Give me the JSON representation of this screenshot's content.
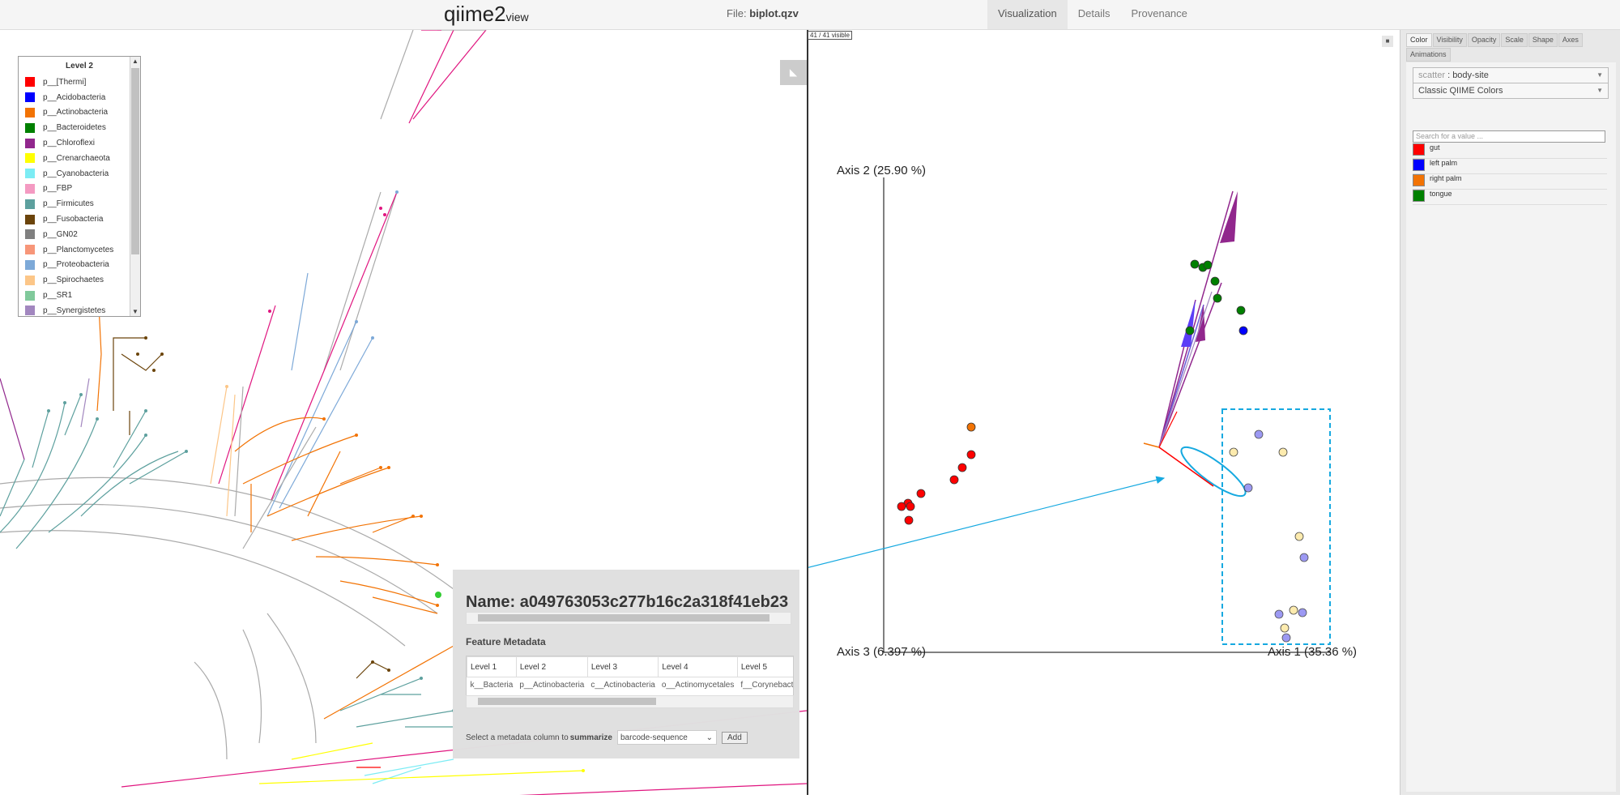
{
  "header": {
    "logo": {
      "brand": "qiime2",
      "suffix": "view"
    },
    "file_prefix": "File:",
    "file_name": "biplot.qzv",
    "tabs": [
      {
        "label": "Visualization",
        "active": true
      },
      {
        "label": "Details",
        "active": false
      },
      {
        "label": "Provenance",
        "active": false
      }
    ]
  },
  "tree_panel": {
    "collapse_icon": "arrow-icon",
    "legend": {
      "title": "Level 2",
      "items": [
        {
          "label": "p__[Thermi]",
          "color": "#ff0000"
        },
        {
          "label": "p__Acidobacteria",
          "color": "#0000ff"
        },
        {
          "label": "p__Actinobacteria",
          "color": "#f27304"
        },
        {
          "label": "p__Bacteroidetes",
          "color": "#008000"
        },
        {
          "label": "p__Chloroflexi",
          "color": "#91278d"
        },
        {
          "label": "p__Crenarchaeota",
          "color": "#ffff00"
        },
        {
          "label": "p__Cyanobacteria",
          "color": "#7cecf4"
        },
        {
          "label": "p__FBP",
          "color": "#f49ac2"
        },
        {
          "label": "p__Firmicutes",
          "color": "#5da09e"
        },
        {
          "label": "p__Fusobacteria",
          "color": "#6b440b"
        },
        {
          "label": "p__GN02",
          "color": "#808080"
        },
        {
          "label": "p__Planctomycetes",
          "color": "#f79679"
        },
        {
          "label": "p__Proteobacteria",
          "color": "#7da9d8"
        },
        {
          "label": "p__Spirochaetes",
          "color": "#fcc688"
        },
        {
          "label": "p__SR1",
          "color": "#80c99b"
        },
        {
          "label": "p__Synergistetes",
          "color": "#a287bf"
        }
      ]
    },
    "popup": {
      "name": "Name: a049763053c277b16c2a318f41eb23",
      "section_title": "Feature Metadata",
      "columns": [
        "Level 1",
        "Level 2",
        "Level 3",
        "Level 4",
        "Level 5"
      ],
      "values": [
        "k__Bacteria",
        "p__Actinobacteria",
        "c__Actinobacteria",
        "o__Actinomycetales",
        "f__Corynebact"
      ],
      "summarize_prefix": "Select a metadata column to",
      "summarize_bold": "summarize",
      "select_value": "barcode-sequence",
      "add_label": "Add"
    }
  },
  "scatter_panel": {
    "visible_count": "41 / 41 visible",
    "axis_labels": {
      "axis2": "Axis 2 (25.90 %)",
      "axis3": "Axis 3 (6.397 %)",
      "axis1": "Axis 1 (35.36 %)"
    },
    "controls": {
      "tabs": [
        {
          "label": "Color",
          "active": true
        },
        {
          "label": "Visibility",
          "active": false
        },
        {
          "label": "Opacity",
          "active": false
        },
        {
          "label": "Scale",
          "active": false
        },
        {
          "label": "Shape",
          "active": false
        },
        {
          "label": "Axes",
          "active": false
        },
        {
          "label": "Animations",
          "active": false
        }
      ],
      "category_prefix": "scatter",
      "category_value": "body-site",
      "colormap": "Classic QIIME Colors",
      "search_placeholder": "Search for a value ...",
      "categories": [
        {
          "label": "gut",
          "color": "#ff0000"
        },
        {
          "label": "left palm",
          "color": "#0000ff"
        },
        {
          "label": "right palm",
          "color": "#f27304"
        },
        {
          "label": "tongue",
          "color": "#008000"
        }
      ]
    }
  }
}
